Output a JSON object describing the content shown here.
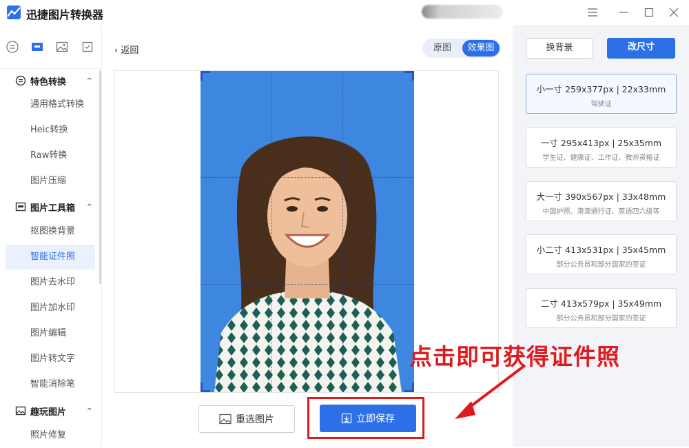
{
  "app": {
    "title": "迅捷图片转换器"
  },
  "window": {
    "menu_icon": "menu-icon",
    "minimize_icon": "minimize-icon",
    "maximize_icon": "maximize-icon",
    "close_icon": "close-icon"
  },
  "toolbar_icons": [
    "list-icon",
    "toolbox-icon",
    "image-icon",
    "crop-icon"
  ],
  "sidebar": {
    "groups": [
      {
        "label": "特色转换",
        "icon": "convert-icon",
        "items": [
          "通用格式转换",
          "Heic转换",
          "Raw转换",
          "图片压缩"
        ]
      },
      {
        "label": "图片工具箱",
        "icon": "toolbox-icon",
        "items": [
          "抠图换背景",
          "智能证件照",
          "图片去水印",
          "图片加水印",
          "图片编辑",
          "图片转文字",
          "智能消除笔"
        ]
      },
      {
        "label": "趣玩图片",
        "icon": "image-icon",
        "items": [
          "照片修复"
        ]
      }
    ],
    "active_item": "智能证件照"
  },
  "editor": {
    "back_label": "返回",
    "toggle": {
      "original": "原图",
      "result": "效果图",
      "selected": "效果图"
    },
    "photo_background": "#3d87e0",
    "reselect_label": "重选图片",
    "save_label": "立即保存"
  },
  "right_panel": {
    "change_bg_label": "换背景",
    "resize_label": "改尺寸",
    "sizes": [
      {
        "title": "小一寸 259x377px | 22x33mm",
        "sub": "驾驶证",
        "selected": true
      },
      {
        "title": "一寸 295x413px | 25x35mm",
        "sub": "学生证、健康证、工作证、教师资格证",
        "selected": false
      },
      {
        "title": "大一寸 390x567px | 33x48mm",
        "sub": "中国护照、港澳通行证、英语四六级等",
        "selected": false
      },
      {
        "title": "小二寸 413x531px | 35x45mm",
        "sub": "部分公务员和部分国家的签证",
        "selected": false
      },
      {
        "title": "二寸 413x579px | 35x49mm",
        "sub": "部分公务员和部分国家的签证",
        "selected": false
      }
    ]
  },
  "annotation": {
    "text": "点击即可获得证件照",
    "color": "#e0191f"
  },
  "colors": {
    "accent": "#2c6fe6",
    "highlight": "#e0191f"
  }
}
